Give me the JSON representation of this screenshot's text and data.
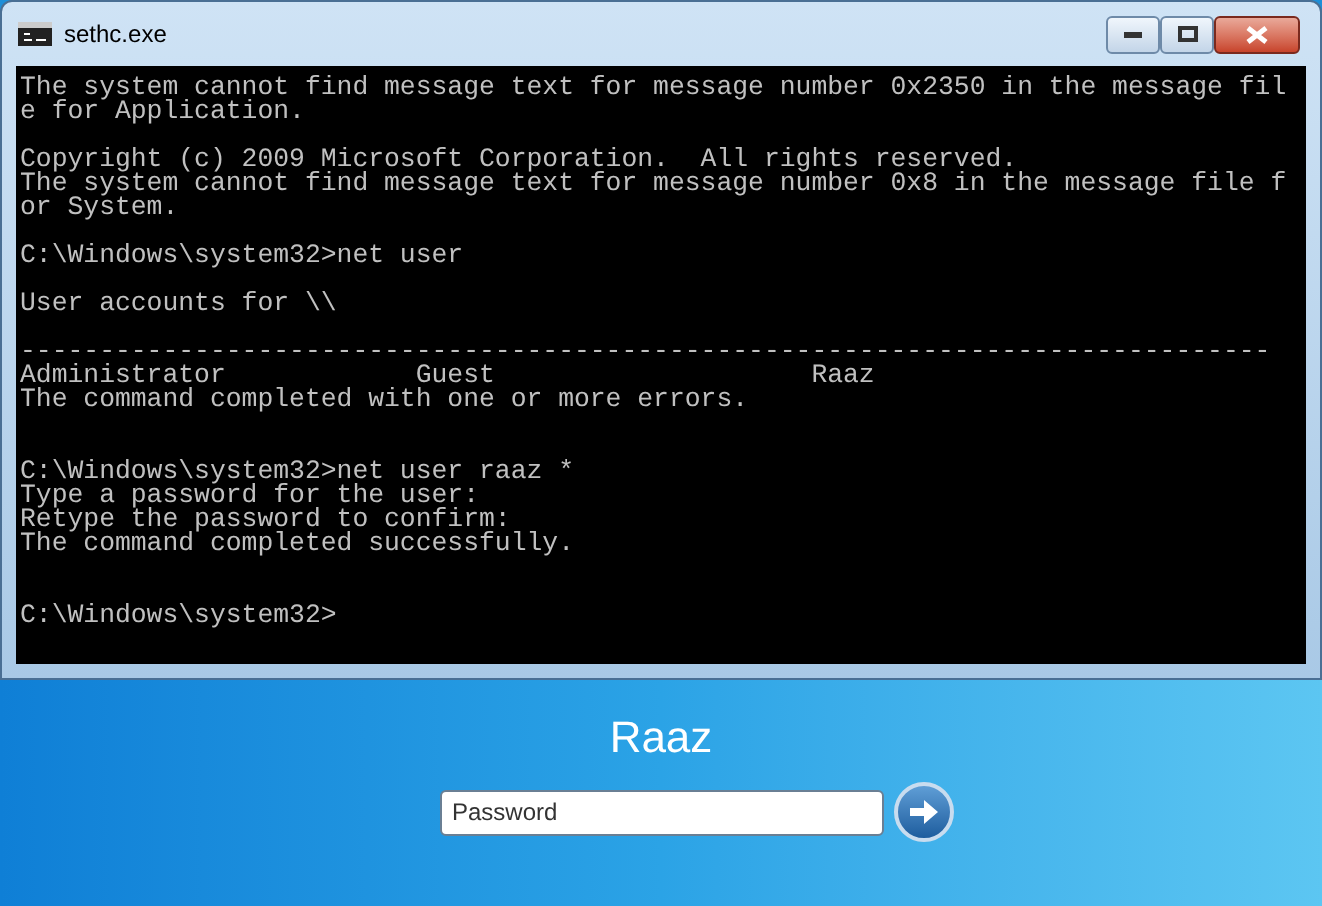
{
  "window": {
    "title": "sethc.exe"
  },
  "console": {
    "sections": [
      {
        "blocks": [
          {
            "lines": [
              "The system cannot find message text for message number 0x2350 in the message fil",
              "e for Application."
            ]
          },
          {
            "lines": [
              "Copyright (c) 2009 Microsoft Corporation.  All rights reserved.",
              "The system cannot find message text for message number 0x8 in the message file f",
              "or System."
            ]
          },
          {
            "lines": [
              "C:\\Windows\\system32>net user"
            ]
          },
          {
            "lines": [
              "User accounts for \\\\"
            ]
          },
          {
            "lines": [
              "-------------------------------------------------------------------------------",
              "Administrator            Guest                    Raaz",
              "The command completed with one or more errors."
            ]
          }
        ]
      },
      {
        "blocks": [
          {
            "lines": [
              "C:\\Windows\\system32>net user raaz *",
              "Type a password for the user:",
              "Retype the password to confirm:",
              "The command completed successfully."
            ]
          }
        ]
      },
      {
        "blocks": [
          {
            "lines": [
              "C:\\Windows\\system32>"
            ]
          }
        ]
      }
    ]
  },
  "login": {
    "user_name": "Raaz",
    "password_field": {
      "placeholder": "Password"
    }
  }
}
